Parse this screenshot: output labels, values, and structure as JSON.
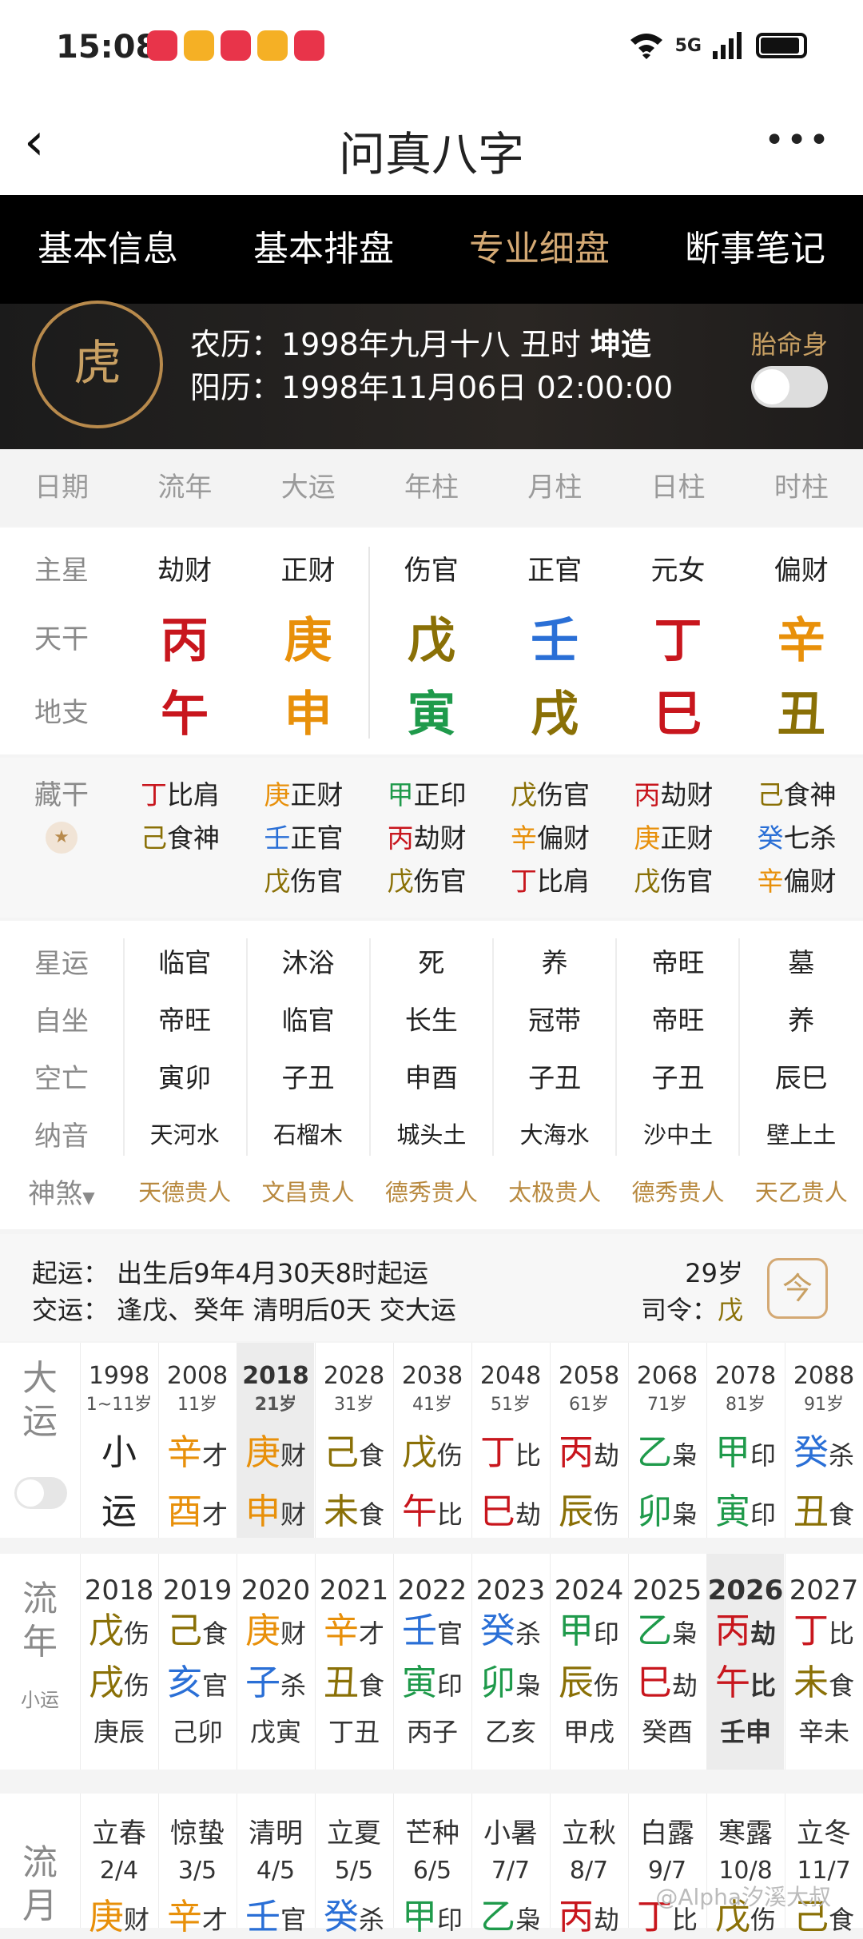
{
  "status": {
    "time": "15:08",
    "network": "5G"
  },
  "header": {
    "title": "问真八字",
    "back": "‹",
    "more": "•••"
  },
  "tabs": [
    "基本信息",
    "基本排盘",
    "专业细盘",
    "断事笔记"
  ],
  "profile": {
    "lunar_prefix": "农历：1998年九月十八 丑时",
    "lunar_suffix": "坤造",
    "solar": "阳历：1998年11月06日 02:00:00",
    "tms_label": "胎命身",
    "avatar_glyph": "虎"
  },
  "columns": [
    "日期",
    "流年",
    "大运",
    "年柱",
    "月柱",
    "日柱",
    "时柱"
  ],
  "stars": {
    "labels": [
      "主星",
      "天干",
      "地支"
    ],
    "main_star": [
      "劫财",
      "正财",
      "伤官",
      "正官",
      "元女",
      "偏财"
    ],
    "stems": [
      "丙",
      "庚",
      "戊",
      "壬",
      "丁",
      "辛"
    ],
    "branches": [
      "午",
      "申",
      "寅",
      "戌",
      "巳",
      "丑"
    ]
  },
  "hidden": {
    "label": "藏干",
    "cols": [
      [
        {
          "s": "丁",
          "t": "比肩"
        },
        {
          "s": "己",
          "t": "食神"
        }
      ],
      [
        {
          "s": "庚",
          "t": "正财"
        },
        {
          "s": "壬",
          "t": "正官"
        },
        {
          "s": "戊",
          "t": "伤官"
        }
      ],
      [
        {
          "s": "甲",
          "t": "正印"
        },
        {
          "s": "丙",
          "t": "劫财"
        },
        {
          "s": "戊",
          "t": "伤官"
        }
      ],
      [
        {
          "s": "戊",
          "t": "伤官"
        },
        {
          "s": "辛",
          "t": "偏财"
        },
        {
          "s": "丁",
          "t": "比肩"
        }
      ],
      [
        {
          "s": "丙",
          "t": "劫财"
        },
        {
          "s": "庚",
          "t": "正财"
        },
        {
          "s": "戊",
          "t": "伤官"
        }
      ],
      [
        {
          "s": "己",
          "t": "食神"
        },
        {
          "s": "癸",
          "t": "七杀"
        },
        {
          "s": "辛",
          "t": "偏财"
        }
      ]
    ]
  },
  "fate": {
    "labels": [
      "星运",
      "自坐",
      "空亡",
      "纳音",
      "神煞"
    ],
    "xingyun": [
      "临官",
      "沐浴",
      "死",
      "养",
      "帝旺",
      "墓"
    ],
    "zizuo": [
      "帝旺",
      "临官",
      "长生",
      "冠带",
      "帝旺",
      "养"
    ],
    "kongwang": [
      "寅卯",
      "子丑",
      "申酉",
      "子丑",
      "子丑",
      "辰巳"
    ],
    "nayin": [
      "天河水",
      "石榴木",
      "城头土",
      "大海水",
      "沙中土",
      "壁上土"
    ],
    "shensha": [
      "天德贵人",
      "文昌贵人",
      "德秀贵人",
      "太极贵人",
      "德秀贵人",
      "天乙贵人"
    ]
  },
  "qiyun": {
    "start": "起运：  出生后9年4月30天8时起运",
    "jiao": "交运：  逢戊、癸年 清明后0天 交大运",
    "age": "29岁",
    "siling_label": "司令：",
    "siling": "戊",
    "icon": "今"
  },
  "dayun": {
    "label": "大运",
    "cols": [
      {
        "y": "1998",
        "a": "1~11岁",
        "g1": "小",
        "t1": "",
        "g2": "运",
        "t2": ""
      },
      {
        "y": "2008",
        "a": "11岁",
        "g1": "辛",
        "t1": "才",
        "g2": "酉",
        "t2": "才"
      },
      {
        "y": "2018",
        "a": "21岁",
        "g1": "庚",
        "t1": "财",
        "g2": "申",
        "t2": "财"
      },
      {
        "y": "2028",
        "a": "31岁",
        "g1": "己",
        "t1": "食",
        "g2": "未",
        "t2": "食"
      },
      {
        "y": "2038",
        "a": "41岁",
        "g1": "戊",
        "t1": "伤",
        "g2": "午",
        "t2": "比"
      },
      {
        "y": "2048",
        "a": "51岁",
        "g1": "丁",
        "t1": "比",
        "g2": "巳",
        "t2": "劫"
      },
      {
        "y": "2058",
        "a": "61岁",
        "g1": "丙",
        "t1": "劫",
        "g2": "辰",
        "t2": "伤"
      },
      {
        "y": "2068",
        "a": "71岁",
        "g1": "乙",
        "t1": "枭",
        "g2": "卯",
        "t2": "枭"
      },
      {
        "y": "2078",
        "a": "81岁",
        "g1": "甲",
        "t1": "印",
        "g2": "寅",
        "t2": "印"
      },
      {
        "y": "2088",
        "a": "91岁",
        "g1": "癸",
        "t1": "杀",
        "g2": "丑",
        "t2": "食"
      }
    ]
  },
  "liunian": {
    "label": "流年",
    "sub": "小运",
    "cols": [
      {
        "y": "2018",
        "g1": "戊",
        "t1": "伤",
        "g2": "戌",
        "t2": "伤",
        "gz": "庚辰"
      },
      {
        "y": "2019",
        "g1": "己",
        "t1": "食",
        "g2": "亥",
        "t2": "官",
        "gz": "己卯"
      },
      {
        "y": "2020",
        "g1": "庚",
        "t1": "财",
        "g2": "子",
        "t2": "杀",
        "gz": "戊寅"
      },
      {
        "y": "2021",
        "g1": "辛",
        "t1": "才",
        "g2": "丑",
        "t2": "食",
        "gz": "丁丑"
      },
      {
        "y": "2022",
        "g1": "壬",
        "t1": "官",
        "g2": "寅",
        "t2": "印",
        "gz": "丙子"
      },
      {
        "y": "2023",
        "g1": "癸",
        "t1": "杀",
        "g2": "卯",
        "t2": "枭",
        "gz": "乙亥"
      },
      {
        "y": "2024",
        "g1": "甲",
        "t1": "印",
        "g2": "辰",
        "t2": "伤",
        "gz": "甲戌"
      },
      {
        "y": "2025",
        "g1": "乙",
        "t1": "枭",
        "g2": "巳",
        "t2": "劫",
        "gz": "癸酉"
      },
      {
        "y": "2026",
        "g1": "丙",
        "t1": "劫",
        "g2": "午",
        "t2": "比",
        "gz": "壬申"
      },
      {
        "y": "2027",
        "g1": "丁",
        "t1": "比",
        "g2": "未",
        "t2": "食",
        "gz": "辛未"
      }
    ]
  },
  "liuyue": {
    "label": "流月",
    "cols": [
      {
        "n": "立春",
        "d": "2/4",
        "g": "庚",
        "t": "财"
      },
      {
        "n": "惊蛰",
        "d": "3/5",
        "g": "辛",
        "t": "才"
      },
      {
        "n": "清明",
        "d": "4/5",
        "g": "壬",
        "t": "官"
      },
      {
        "n": "立夏",
        "d": "5/5",
        "g": "癸",
        "t": "杀"
      },
      {
        "n": "芒种",
        "d": "6/5",
        "g": "甲",
        "t": "印"
      },
      {
        "n": "小暑",
        "d": "7/7",
        "g": "乙",
        "t": "枭"
      },
      {
        "n": "立秋",
        "d": "8/7",
        "g": "丙",
        "t": "劫"
      },
      {
        "n": "白露",
        "d": "9/7",
        "g": "丁",
        "t": "比"
      },
      {
        "n": "寒露",
        "d": "10/8",
        "g": "戊",
        "t": "伤"
      },
      {
        "n": "立冬",
        "d": "11/7",
        "g": "己",
        "t": "食"
      }
    ]
  },
  "watermark": "@Alpha汐溪大叔"
}
